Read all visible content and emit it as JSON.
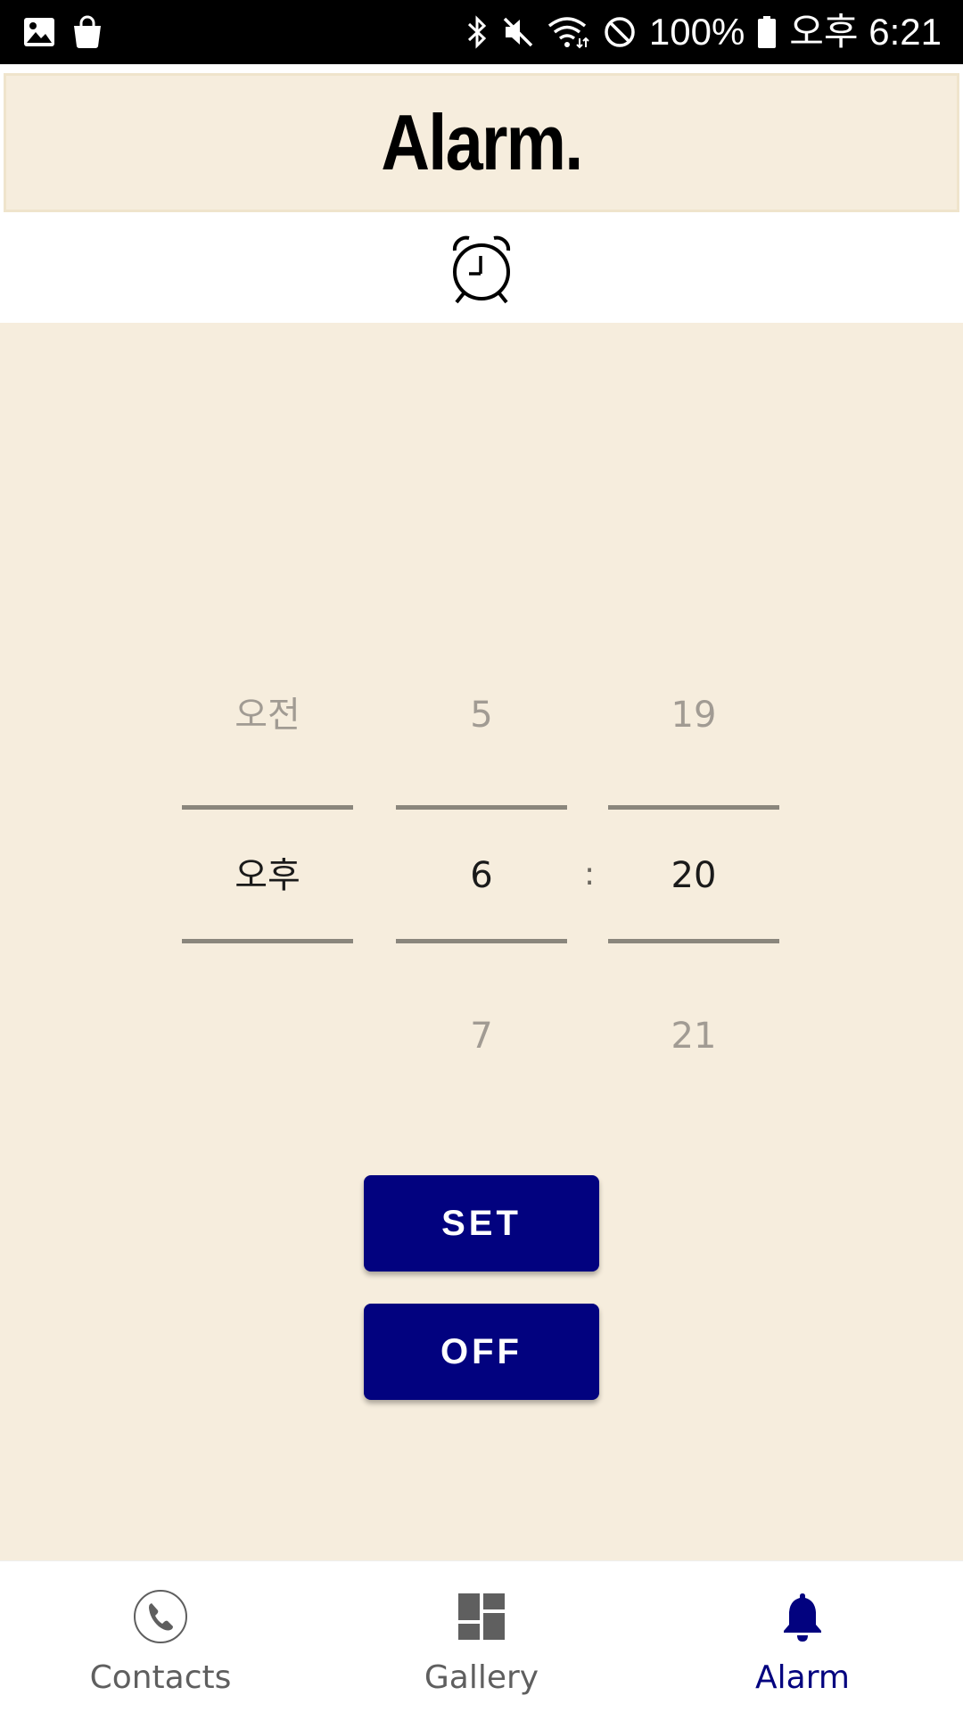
{
  "status_bar": {
    "battery": "100%",
    "time": "오후 6:21",
    "icons": [
      "gallery-icon",
      "shopping-bag-icon",
      "bluetooth-icon",
      "mute-icon",
      "wifi-icon",
      "do-not-disturb-icon",
      "battery-icon"
    ]
  },
  "header": {
    "title": "Alarm."
  },
  "clock_icon": "alarm-clock-icon",
  "picker": {
    "ampm": {
      "prev": "오전",
      "selected": "오후",
      "next": ""
    },
    "hour": {
      "prev": "5",
      "selected": "6",
      "next": "7"
    },
    "separator": ":",
    "minute": {
      "prev": "19",
      "selected": "20",
      "next": "21"
    }
  },
  "buttons": {
    "set": "SET",
    "off": "OFF"
  },
  "nav": {
    "items": [
      {
        "label": "Contacts",
        "icon": "phone-icon",
        "active": false
      },
      {
        "label": "Gallery",
        "icon": "dashboard-icon",
        "active": false
      },
      {
        "label": "Alarm",
        "icon": "bell-icon",
        "active": true
      }
    ]
  },
  "colors": {
    "background": "#f6eddd",
    "accent": "#02027f",
    "nav_inactive": "#5f5f5f"
  }
}
